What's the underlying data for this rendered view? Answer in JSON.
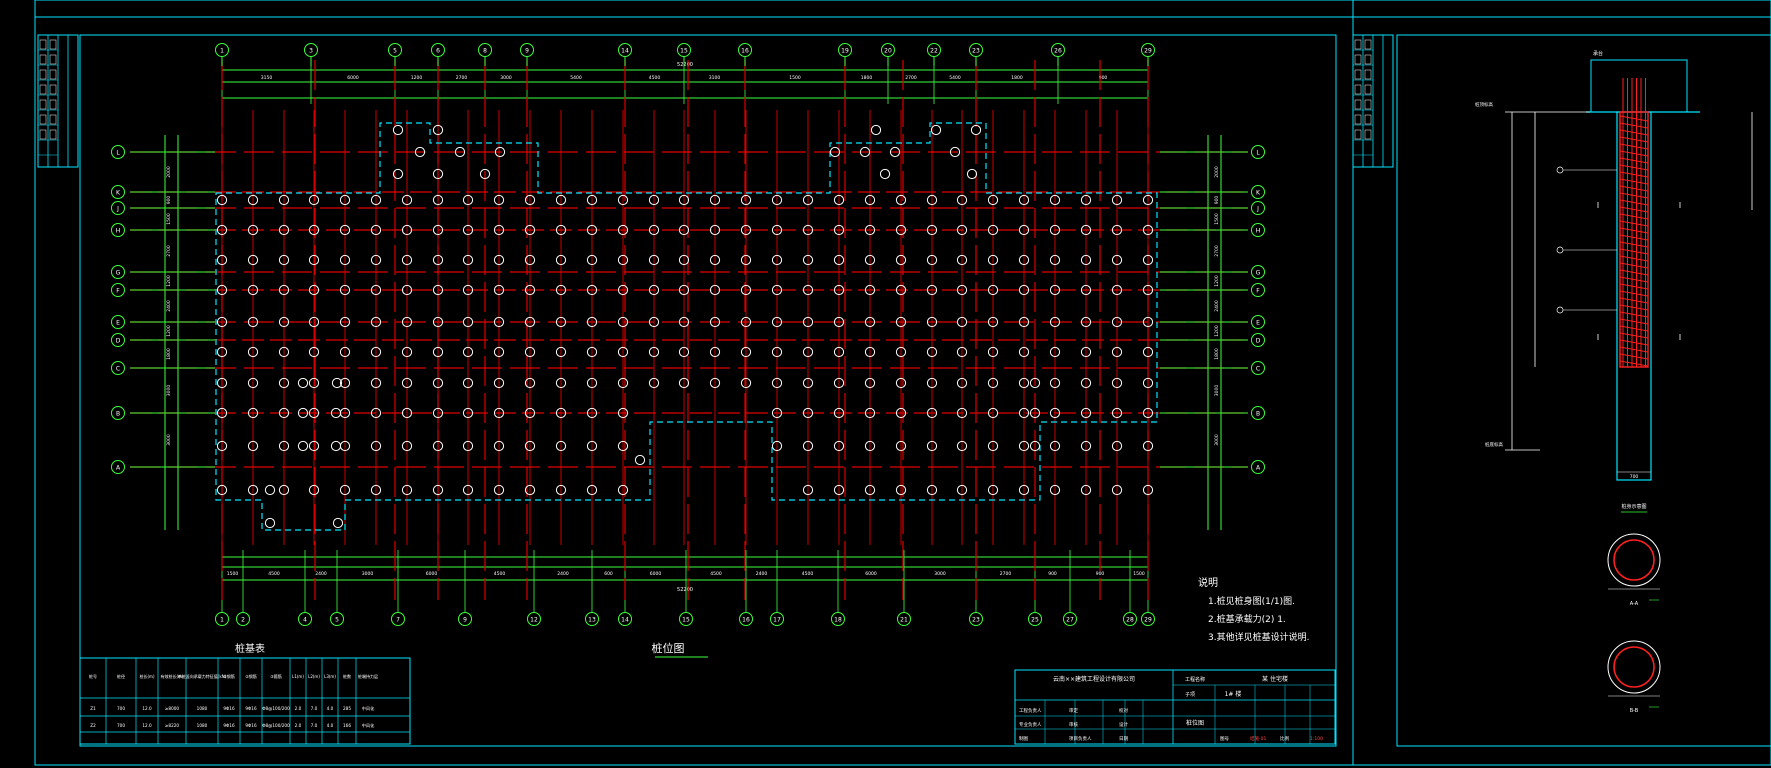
{
  "colors": {
    "background": "#000000",
    "frame": "#00e5ff",
    "axis": "#3bff3b",
    "grid_line": "#e00000",
    "pile": "#ffffff",
    "rebar": "#ff2020"
  },
  "plan": {
    "title": "桩位图",
    "top_axes": [
      "1",
      "3",
      "5",
      "6",
      "8",
      "9",
      "14",
      "15",
      "16",
      "19",
      "20",
      "22",
      "23",
      "26",
      "29"
    ],
    "bottom_axes": [
      "1",
      "2",
      "4",
      "5",
      "7",
      "9",
      "12",
      "13",
      "14",
      "15",
      "16",
      "17",
      "18",
      "21",
      "23",
      "25",
      "27",
      "28",
      "29"
    ],
    "row_axes_left": [
      "L",
      "K",
      "J",
      "H",
      "G",
      "F",
      "E",
      "D",
      "C",
      "B",
      "A"
    ],
    "row_axes_right": [
      "L",
      "K",
      "J",
      "H",
      "G",
      "F",
      "E",
      "D",
      "C",
      "B",
      "A"
    ],
    "overall_dim": "52200",
    "rows": 11,
    "cols": 31
  },
  "notes": {
    "heading": "说明",
    "items": [
      "1.桩见桩身图(1/1)图.",
      "2.桩基承载力(2) 1.",
      "3.其他详见桩基设计说明."
    ]
  },
  "pile_table": {
    "title": "桩基表",
    "headers": [
      "桩号",
      "桩径",
      "桩长(m)",
      "有效桩长(m)",
      "单桩竖向承载力特征值(kN)",
      "①钢筋",
      "②钢筋",
      "③箍筋",
      "L1(m)",
      "L2(m)",
      "L3(m)",
      "桩数",
      "桩端持力层"
    ],
    "rows": [
      [
        "Z1",
        "700",
        "12.0",
        "≥8000",
        "1080",
        "9Φ16",
        "9Φ16",
        "Φ8@100/200",
        "2.0",
        "7.0",
        "4.0",
        "285",
        "中风化"
      ],
      [
        "Z2",
        "700",
        "12.0",
        "≥8220",
        "1080",
        "9Φ16",
        "9Φ16",
        "Φ8@100/200",
        "2.0",
        "7.0",
        "4.0",
        "166",
        "中风化"
      ]
    ]
  },
  "title_block": {
    "company": "云南××建筑工程设计有限公司",
    "project_label": "工程名称",
    "project": "某 住宅楼",
    "sub_label": "子项",
    "sub_project": "1# 楼",
    "drawing_name": "桩位图",
    "rows": [
      [
        "工程负责人",
        "审定",
        "校对"
      ],
      [
        "专业负责人",
        "审核",
        "设计"
      ],
      [
        "制图",
        "项目负责人",
        "日期"
      ]
    ],
    "meta": [
      "图号",
      "结施-01",
      "比例",
      "1:100"
    ]
  },
  "detail": {
    "section_title": "桩身示意图",
    "section_a": "A-A",
    "section_b": "B-B",
    "pile_dia": "700",
    "head_label": "承台",
    "top_label": "桩顶标高",
    "bottom_label": "桩底标高"
  }
}
